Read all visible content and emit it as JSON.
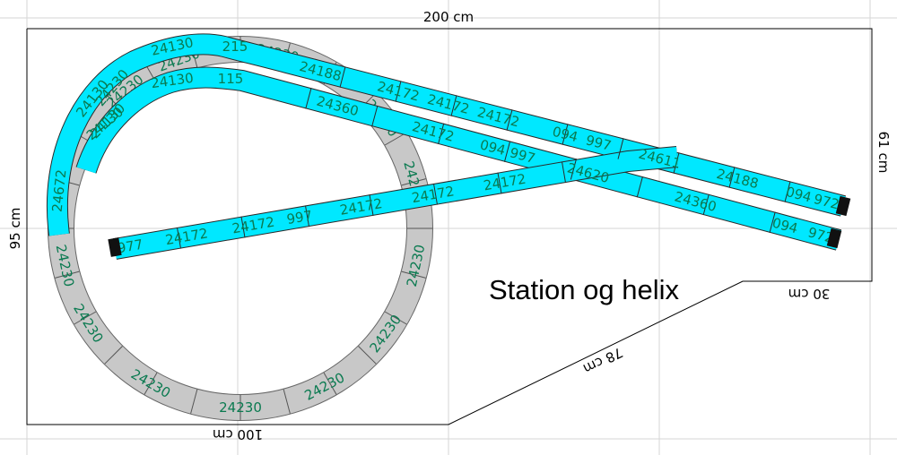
{
  "title": "Station og helix",
  "dimensions": {
    "top": "200 cm",
    "left": "95 cm",
    "right": "61 cm",
    "step": "30 cm",
    "diagonal": "78 cm",
    "bottom": "100 cm"
  },
  "colors": {
    "track": "#00e8ff",
    "helix": "#c8c8c8",
    "label": "#0a7a50",
    "grid": "#d6d6d6",
    "outline": "#000000",
    "buffer": "#111111"
  },
  "helix_labels": [
    "24230",
    "24230",
    "24230",
    "24230",
    "24230",
    "24230",
    "24230",
    "24230",
    "24230",
    "24230",
    "24230",
    "24230",
    "24230"
  ],
  "outer_curve_labels": [
    "24672",
    "24130",
    "24130",
    "24130",
    "215"
  ],
  "inner_curve_labels": [
    "24230",
    "24130",
    "24130",
    "115"
  ],
  "upper_line_labels": [
    "24188",
    "24172",
    "24172",
    "24172",
    "094",
    "997",
    "24611",
    "24188",
    "094",
    "972"
  ],
  "lower_line_labels": [
    "24360",
    "24172",
    "094",
    "997",
    "24620",
    "24360",
    "094",
    "972"
  ],
  "diagonal_labels": [
    "977",
    "24172",
    "24172",
    "997",
    "24172",
    "24172",
    "24172"
  ]
}
